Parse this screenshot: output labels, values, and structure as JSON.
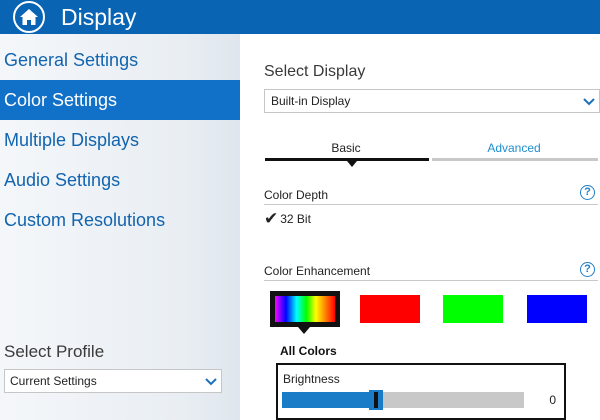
{
  "header": {
    "title": "Display",
    "home_icon": "home-icon"
  },
  "sidebar": {
    "items": [
      {
        "label": "General Settings",
        "active": false
      },
      {
        "label": "Color Settings",
        "active": true
      },
      {
        "label": "Multiple Displays",
        "active": false
      },
      {
        "label": "Audio Settings",
        "active": false
      },
      {
        "label": "Custom Resolutions",
        "active": false
      }
    ],
    "profile_label": "Select Profile",
    "profile_value": "Current Settings"
  },
  "main": {
    "select_display_label": "Select Display",
    "display_value": "Built-in Display",
    "tabs": [
      {
        "label": "Basic",
        "active": true
      },
      {
        "label": "Advanced",
        "active": false
      }
    ],
    "color_depth": {
      "label": "Color Depth",
      "value": "32 Bit",
      "help": "?"
    },
    "color_enhancement": {
      "label": "Color Enhancement",
      "help": "?",
      "swatches": [
        {
          "name": "all-colors",
          "color": "rainbow",
          "selected": true
        },
        {
          "name": "red",
          "color": "#ff0000",
          "selected": false
        },
        {
          "name": "green",
          "color": "#00ff00",
          "selected": false
        },
        {
          "name": "blue",
          "color": "#0000ff",
          "selected": false
        }
      ],
      "selected_label": "All Colors",
      "brightness": {
        "label": "Brightness",
        "value": "0",
        "level": 0.39
      }
    }
  },
  "colors": {
    "accent": "#0a64b4",
    "active_nav": "#1170c8",
    "link": "#1f8ecf"
  }
}
